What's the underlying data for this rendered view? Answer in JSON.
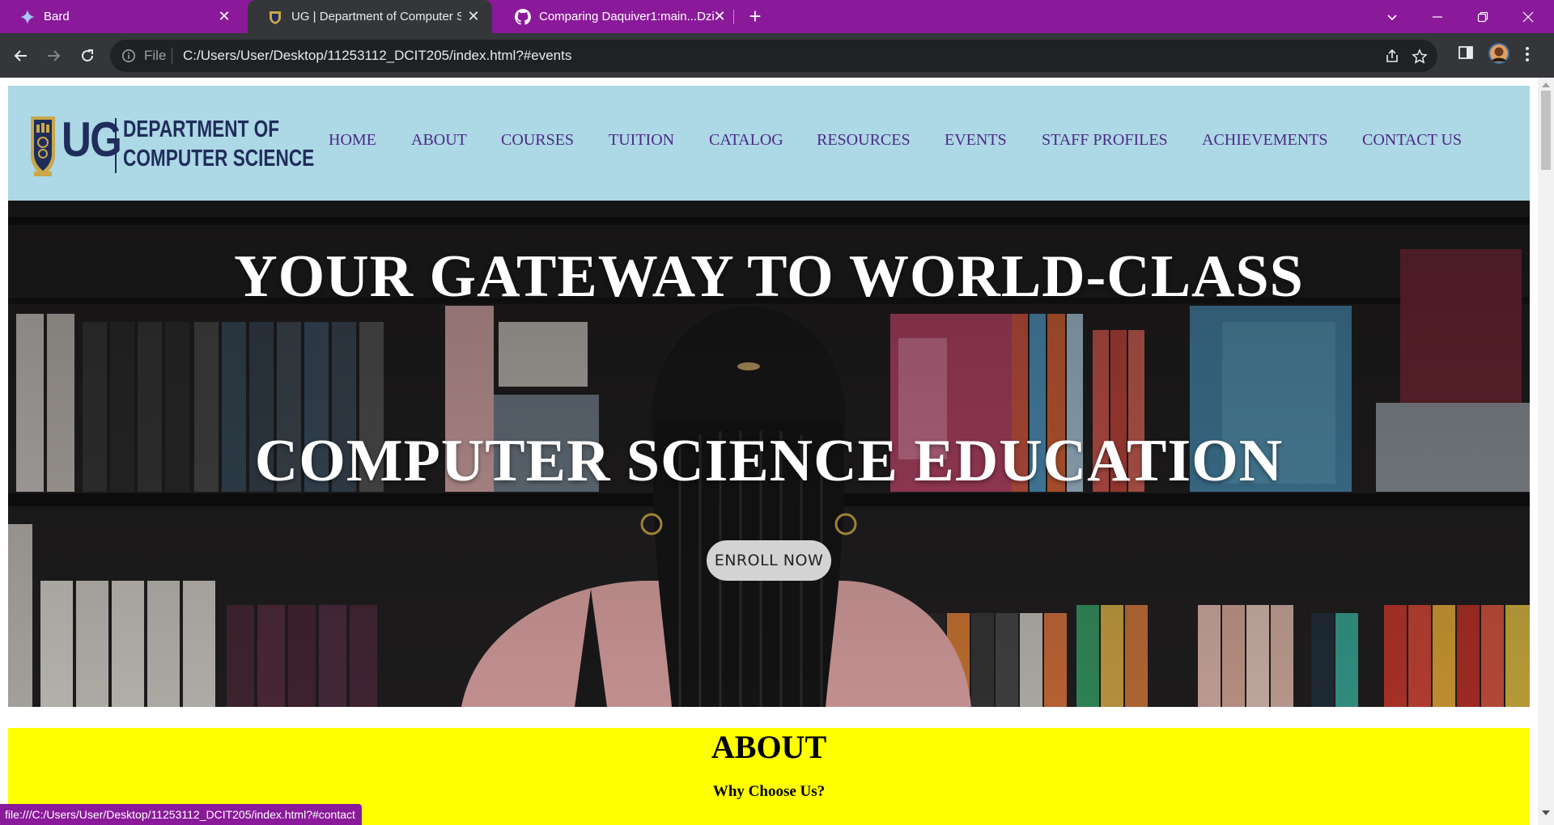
{
  "browser": {
    "tabs": [
      {
        "title": "Bard",
        "icon": "bard-sparkle-icon",
        "active": false
      },
      {
        "title": "UG | Department of Computer Sci",
        "icon": "ug-crest-icon",
        "active": true
      },
      {
        "title": "Comparing Daquiver1:main...Dzi",
        "icon": "github-icon",
        "active": false
      }
    ],
    "new_tab_label": "+",
    "omnibox": {
      "scheme_label": "File",
      "url": "C:/Users/User/Desktop/11253112_DCIT205/index.html?#events"
    },
    "status_url": "file:///C:/Users/User/Desktop/11253112_DCIT205/index.html?#contact",
    "frame_color": "#8a1a9a"
  },
  "site": {
    "logo": {
      "initials": "UG",
      "line1": "DEPARTMENT OF",
      "line2": "COMPUTER SCIENCE"
    },
    "nav": [
      "HOME",
      "ABOUT",
      "COURSES",
      "TUITION",
      "CATALOG",
      "RESOURCES",
      "EVENTS",
      "STAFF PROFILES",
      "ACHIEVEMENTS",
      "CONTACT US"
    ],
    "hero": {
      "line1": "YOUR GATEWAY TO WORLD-CLASS",
      "line2": "COMPUTER SCIENCE EDUCATION",
      "cta": "ENROLL NOW"
    },
    "about": {
      "title": "ABOUT",
      "subtitle": "Why Choose Us?"
    },
    "colors": {
      "header_bg": "#add8e6",
      "nav_text": "#4b2a86",
      "about_bg": "#ffff00",
      "logo_navy": "#1f2d5a"
    }
  }
}
